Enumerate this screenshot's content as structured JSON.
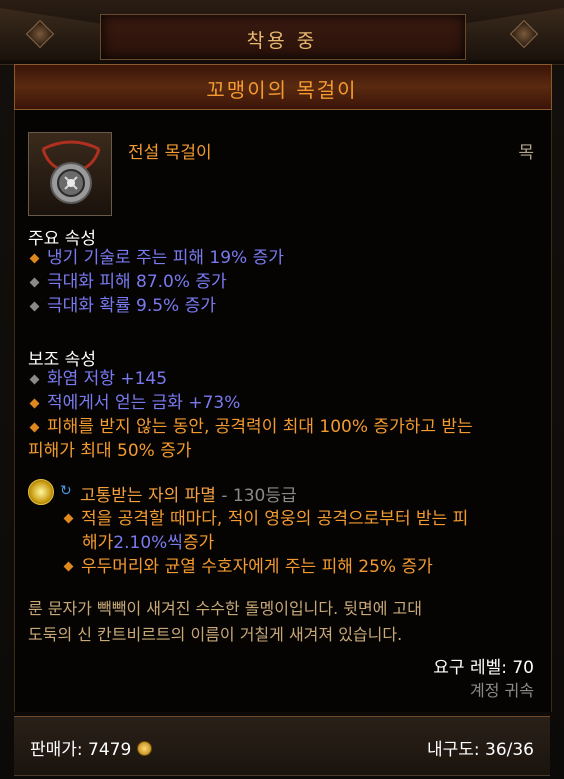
{
  "header": {
    "equipped_label": "착용 중",
    "item_name": "꼬맹이의 목걸이"
  },
  "item": {
    "type": "전설 목걸이",
    "slot": "목",
    "icon": "amulet-icon"
  },
  "primary": {
    "title": "주요 속성",
    "stats": [
      {
        "text": "냉기 기술로 주는 피해 19% 증가",
        "bullet": "orange"
      },
      {
        "text": "극대화 피해 87.0% 증가",
        "bullet": "gray"
      },
      {
        "text": "극대화 확률 9.5% 증가",
        "bullet": "gray"
      }
    ]
  },
  "secondary": {
    "title": "보조 속성",
    "stats": [
      {
        "text": "화염 저항 +145",
        "bullet": "gray"
      },
      {
        "text": "적에게서 얻는 금화 +73%",
        "bullet": "orange"
      },
      {
        "text": "피해를 받지 않는 동안, 공격력이 최대 100% 증가하고 받는",
        "bullet": "orange"
      },
      {
        "text": "피해가 최대 50% 증가",
        "bullet": ""
      }
    ]
  },
  "legendary_gem": {
    "name": "고통받는 자의 파멸",
    "rank": " - 130등급",
    "effects": [
      {
        "line1": "적을 공격할 때마다, 적이 영웅의 공격으로부터 받는 피",
        "line2_pre": "해가 ",
        "line2_val": "2.10%씩",
        "line2_post": " 증가"
      },
      {
        "line1": "우두머리와 균열 수호자에게 주는 피해 25% 증가"
      }
    ]
  },
  "flavor": {
    "line1": "룬 문자가 빽빽이 새겨진 수수한 돌멩이입니다. 뒷면에 고대",
    "line2": "도둑의 신 칸트비르트의 이름이 거칠게 새겨져 있습니다."
  },
  "requirements": {
    "level": "요구 레벨: 70",
    "bound": "계정 귀속"
  },
  "footer": {
    "sell_value": "판매가: 7479",
    "durability": "내구도: 36/36"
  },
  "colors": {
    "legendary_orange": "#f39a30",
    "magic_blue": "#7a7af0"
  }
}
